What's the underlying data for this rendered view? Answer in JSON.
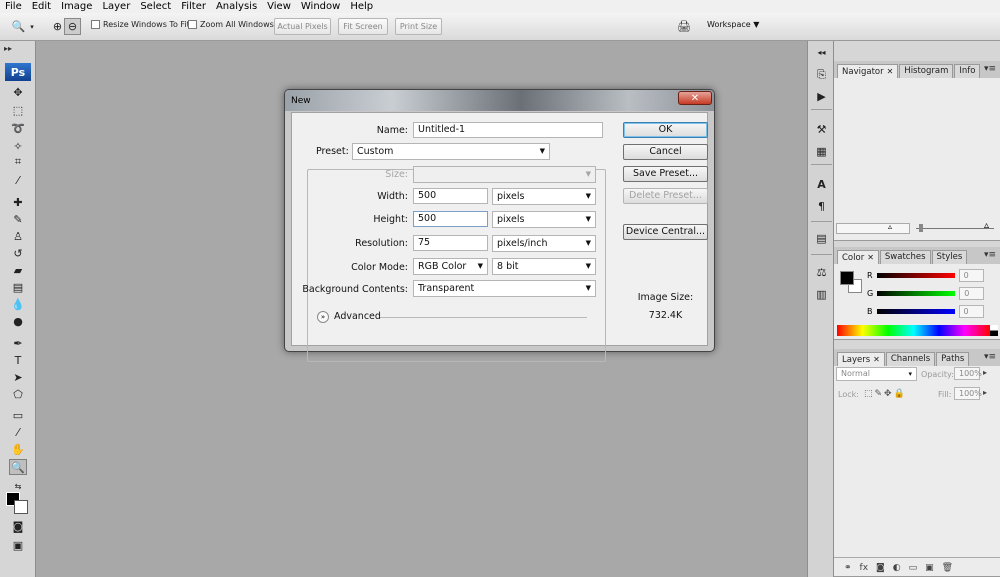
{
  "menu": [
    "File",
    "Edit",
    "Image",
    "Layer",
    "Select",
    "Filter",
    "Analysis",
    "View",
    "Window",
    "Help"
  ],
  "options_bar": {
    "resize_windows_label": "Resize Windows To Fit",
    "zoom_all_label": "Zoom All Windows",
    "actual_pixels_label": "Actual Pixels",
    "fit_screen_label": "Fit Screen",
    "print_size_label": "Print Size",
    "workspace_label": "Workspace ▼"
  },
  "toolbox": {
    "logo": "Ps"
  },
  "panels": {
    "navigator_tabs": [
      "Navigator",
      "Histogram",
      "Info"
    ],
    "color_tabs": [
      "Color",
      "Swatches",
      "Styles"
    ],
    "color_channels": [
      {
        "label": "R",
        "value": "0",
        "gradient": "#000000,#ff0000"
      },
      {
        "label": "G",
        "value": "0",
        "gradient": "#000000,#00ff00"
      },
      {
        "label": "B",
        "value": "0",
        "gradient": "#000000,#0000ff"
      }
    ],
    "layers_tabs": [
      "Layers",
      "Channels",
      "Paths"
    ],
    "blend_mode": "Normal",
    "opacity_label": "Opacity:",
    "opacity_value": "100%",
    "lock_label": "Lock:",
    "fill_label": "Fill:",
    "fill_value": "100%"
  },
  "dialog": {
    "title": "New",
    "name_label": "Name:",
    "name_value": "Untitled-1",
    "preset_label": "Preset:",
    "preset_value": "Custom",
    "size_label": "Size:",
    "size_value": "",
    "width_label": "Width:",
    "width_value": "500",
    "width_unit": "pixels",
    "height_label": "Height:",
    "height_value": "500",
    "height_unit": "pixels",
    "resolution_label": "Resolution:",
    "resolution_value": "75",
    "resolution_unit": "pixels/inch",
    "color_mode_label": "Color Mode:",
    "color_mode_value": "RGB Color",
    "bit_depth_value": "8 bit",
    "bg_contents_label": "Background Contents:",
    "bg_contents_value": "Transparent",
    "advanced_label": "Advanced",
    "image_size_label": "Image Size:",
    "image_size_value": "732.4K",
    "buttons": {
      "ok": "OK",
      "cancel": "Cancel",
      "save_preset": "Save Preset...",
      "delete_preset": "Delete Preset...",
      "device_central": "Device Central..."
    }
  },
  "colors": {
    "workspace_bg": "#a8a8a8",
    "ps_blue": "#1f5fb6",
    "default_button_border": "#3c7fb1",
    "close_red": "#c63a24"
  }
}
